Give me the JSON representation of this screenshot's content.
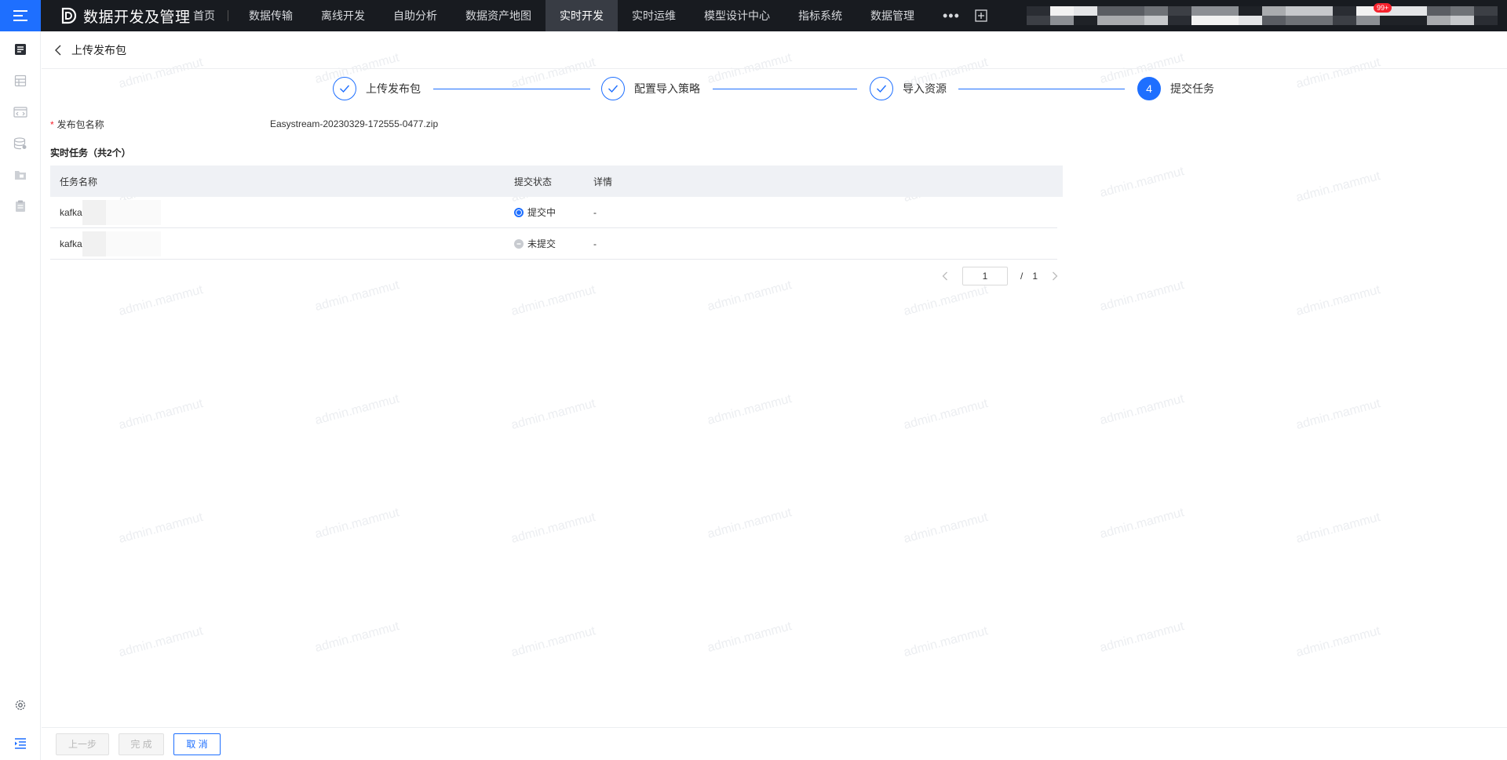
{
  "app": {
    "title": "数据开发及管理"
  },
  "nav": {
    "items": [
      {
        "label": "首页",
        "active": false
      },
      {
        "label": "数据传输",
        "active": false
      },
      {
        "label": "离线开发",
        "active": false
      },
      {
        "label": "自助分析",
        "active": false
      },
      {
        "label": "数据资产地图",
        "active": false
      },
      {
        "label": "实时开发",
        "active": true
      },
      {
        "label": "实时运维",
        "active": false
      },
      {
        "label": "模型设计中心",
        "active": false
      },
      {
        "label": "指标系统",
        "active": false
      },
      {
        "label": "数据管理",
        "active": false
      }
    ],
    "more": "•••",
    "badge": "99+"
  },
  "page": {
    "title": "上传发布包"
  },
  "steps": [
    {
      "label": "上传发布包",
      "status": "done"
    },
    {
      "label": "配置导入策略",
      "status": "done"
    },
    {
      "label": "导入资源",
      "status": "done"
    },
    {
      "label": "提交任务",
      "status": "current",
      "number": "4"
    }
  ],
  "form": {
    "required_mark": "*",
    "package_label": "发布包名称",
    "package_value": "Easystream-20230329-172555-0477.zip"
  },
  "section": {
    "title": "实时任务（共2个）"
  },
  "table": {
    "columns": [
      "任务名称",
      "提交状态",
      "详情"
    ],
    "rows": [
      {
        "name": "kafka",
        "status": "提交中",
        "status_type": "in-progress",
        "detail": "-"
      },
      {
        "name": "kafka",
        "status": "未提交",
        "status_type": "not-submitted",
        "detail": "-"
      }
    ]
  },
  "pagination": {
    "current": "1",
    "slash": "/",
    "total": "1"
  },
  "watermark": "admin.mammut",
  "footer": {
    "prev": "上一步",
    "finish": "完 成",
    "cancel": "取 消"
  },
  "colors": {
    "primary": "#1e6fff",
    "topbar": "#181b20",
    "active_nav": "#383c44",
    "required": "#f5222d"
  }
}
